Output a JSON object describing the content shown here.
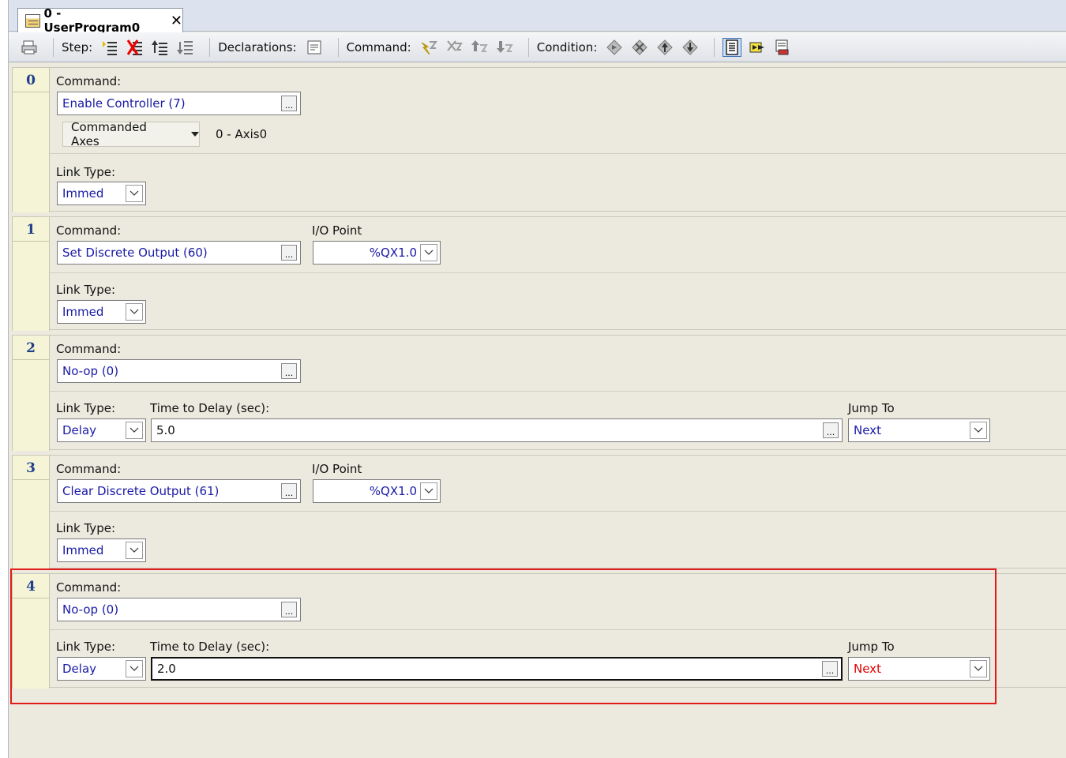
{
  "tab": {
    "title": "0 - UserProgram0",
    "close": "✕"
  },
  "toolbar": {
    "step_label": "Step:",
    "declarations_label": "Declarations:",
    "command_label": "Command:",
    "condition_label": "Condition:"
  },
  "labels": {
    "command": "Command:",
    "link_type": "Link Type:",
    "io_point": "I/O Point",
    "time_to_delay": "Time to Delay (sec):",
    "jump_to": "Jump To",
    "ellipsis": "..."
  },
  "steps": [
    {
      "number": "0",
      "command": "Enable Controller (7)",
      "axes_dropdown": "Commanded Axes",
      "axes_value": "0 - Axis0",
      "link_type": "Immed"
    },
    {
      "number": "1",
      "command": "Set Discrete Output (60)",
      "io_point": "%QX1.0",
      "link_type": "Immed"
    },
    {
      "number": "2",
      "command": "No-op (0)",
      "link_type": "Delay",
      "delay": "5.0",
      "jump_to": "Next"
    },
    {
      "number": "3",
      "command": "Clear Discrete Output (61)",
      "io_point": "%QX1.0",
      "link_type": "Immed"
    },
    {
      "number": "4",
      "command": "No-op (0)",
      "link_type": "Delay",
      "delay": "2.0",
      "jump_to": "Next"
    }
  ],
  "colors": {
    "value_text": "#1a1aa6",
    "highlight": "#e21a1a",
    "jump_red": "#e00000",
    "step_number": "#1f3f8a"
  }
}
